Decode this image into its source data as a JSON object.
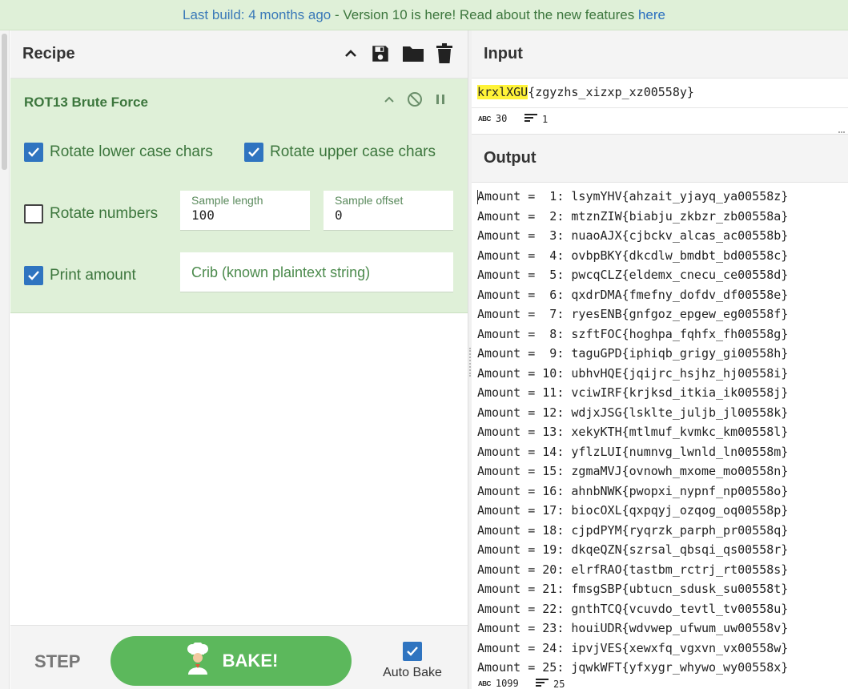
{
  "banner": {
    "part1": "Last build: 4 months ago",
    "sep": " - ",
    "part2": "Version 10 is here! Read about the new features ",
    "link": "here"
  },
  "recipe": {
    "title": "Recipe",
    "operation": {
      "title": "ROT13 Brute Force",
      "rotate_lower": {
        "label": "Rotate lower case chars",
        "checked": true
      },
      "rotate_upper": {
        "label": "Rotate upper case chars",
        "checked": true
      },
      "rotate_numbers": {
        "label": "Rotate numbers",
        "checked": false
      },
      "sample_length": {
        "label": "Sample length",
        "value": "100"
      },
      "sample_offset": {
        "label": "Sample offset",
        "value": "0"
      },
      "print_amount": {
        "label": "Print amount",
        "checked": true
      },
      "crib": {
        "placeholder": "Crib (known plaintext string)"
      }
    },
    "step_label": "STEP",
    "bake_label": "BAKE!",
    "auto_bake": {
      "label": "Auto Bake",
      "checked": true
    }
  },
  "input": {
    "title": "Input",
    "highlighted": "krxlXGU",
    "rest": "{zgyzhs_xizxp_xz00558y}",
    "length_value": "30",
    "lines_value": "1"
  },
  "output": {
    "title": "Output",
    "lines": [
      "Amount =  1: lsymYHV{ahzait_yjayq_ya00558z}",
      "Amount =  2: mtznZIW{biabju_zkbzr_zb00558a}",
      "Amount =  3: nuaoAJX{cjbckv_alcas_ac00558b}",
      "Amount =  4: ovbpBKY{dkcdlw_bmdbt_bd00558c}",
      "Amount =  5: pwcqCLZ{eldemx_cnecu_ce00558d}",
      "Amount =  6: qxdrDMA{fmefny_dofdv_df00558e}",
      "Amount =  7: ryesENB{gnfgoz_epgew_eg00558f}",
      "Amount =  8: szftFOC{hoghpa_fqhfx_fh00558g}",
      "Amount =  9: taguGPD{iphiqb_grigy_gi00558h}",
      "Amount = 10: ubhvHQE{jqijrc_hsjhz_hj00558i}",
      "Amount = 11: vciwIRF{krjksd_itkia_ik00558j}",
      "Amount = 12: wdjxJSG{lsklte_juljb_jl00558k}",
      "Amount = 13: xekyKTH{mtlmuf_kvmkc_km00558l}",
      "Amount = 14: yflzLUI{numnvg_lwnld_ln00558m}",
      "Amount = 15: zgmaMVJ{ovnowh_mxome_mo00558n}",
      "Amount = 16: ahnbNWK{pwopxi_nypnf_np00558o}",
      "Amount = 17: biocOXL{qxpqyj_ozqog_oq00558p}",
      "Amount = 18: cjpdPYM{ryqrzk_parph_pr00558q}",
      "Amount = 19: dkqeQZN{szrsal_qbsqi_qs00558r}",
      "Amount = 20: elrfRAO{tastbm_rctrj_rt00558s}",
      "Amount = 21: fmsgSBP{ubtucn_sdusk_su00558t}",
      "Amount = 22: gnthTCQ{vcuvdo_tevtl_tv00558u}",
      "Amount = 23: houiUDR{wdvwep_ufwum_uw00558v}",
      "Amount = 24: ipvjVES{xewxfq_vgxvn_vx00558w}",
      "Amount = 25: jqwkWFT{yfxygr_whywo_wy00558x}"
    ],
    "length_value": "1099",
    "lines_value": "25"
  },
  "colors": {
    "accent_green": "#5cb85c",
    "op_background": "#dff0d8",
    "checkbox_blue": "#2f74c0",
    "highlight": "#fff338"
  },
  "icons": [
    "chevron-up-icon",
    "save-icon",
    "folder-icon",
    "trash-icon",
    "disable-icon",
    "pause-icon",
    "chef-icon",
    "abc-icon",
    "lines-icon"
  ]
}
